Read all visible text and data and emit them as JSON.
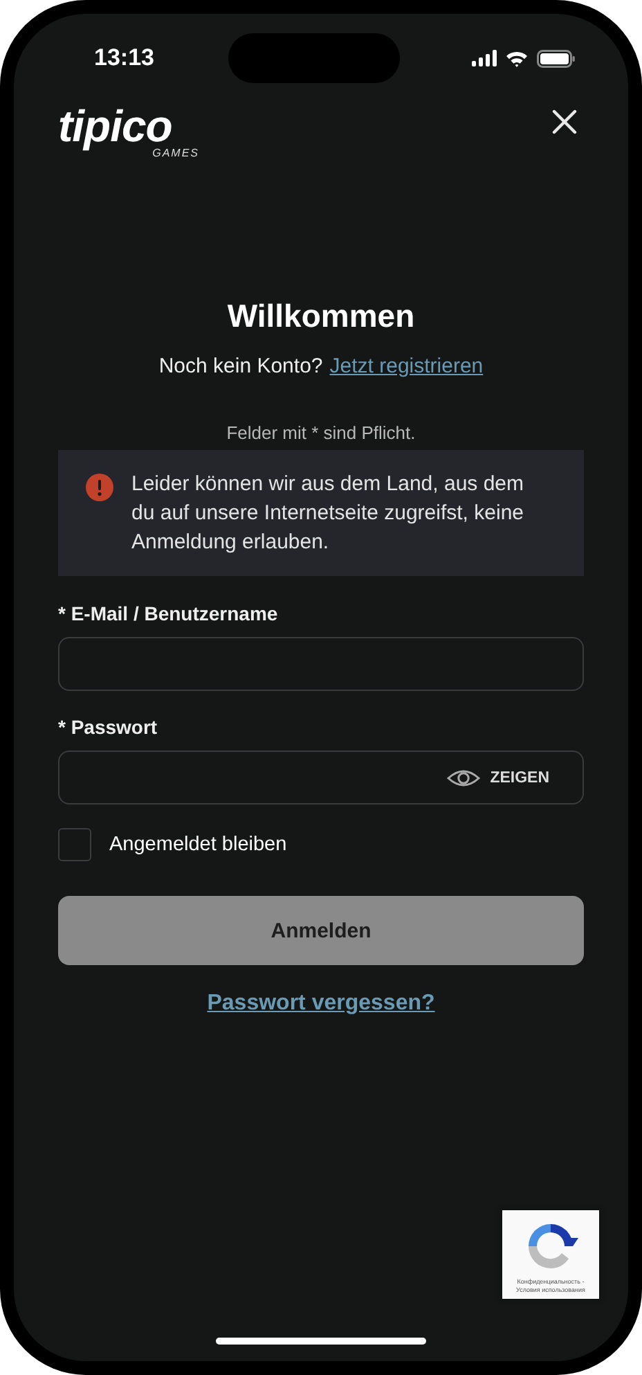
{
  "status_bar": {
    "time": "13:13"
  },
  "header": {
    "logo": "tipico",
    "logo_sub": "GAMES"
  },
  "title": "Willkommen",
  "register": {
    "prompt": "Noch kein Konto?",
    "link": "Jetzt registrieren"
  },
  "required_note": "Felder mit * sind Pflicht.",
  "alert": {
    "kind": "error",
    "message": "Leider können wir aus dem Land, aus dem du auf unsere Internetseite zugreifst, keine Anmeldung erlauben."
  },
  "fields": [
    {
      "kind": "text",
      "label": "* E-Mail / Benutzername"
    },
    {
      "kind": "password",
      "label": "* Passwort",
      "toggle": "ZEIGEN"
    }
  ],
  "remember": {
    "label": "Angemeldet bleiben",
    "checked": false
  },
  "submit": {
    "label": "Anmelden",
    "disabled": true
  },
  "forgot_link": "Passwort vergessen?",
  "recaptcha": {
    "text": "Конфиденциальность - Условия использования"
  }
}
